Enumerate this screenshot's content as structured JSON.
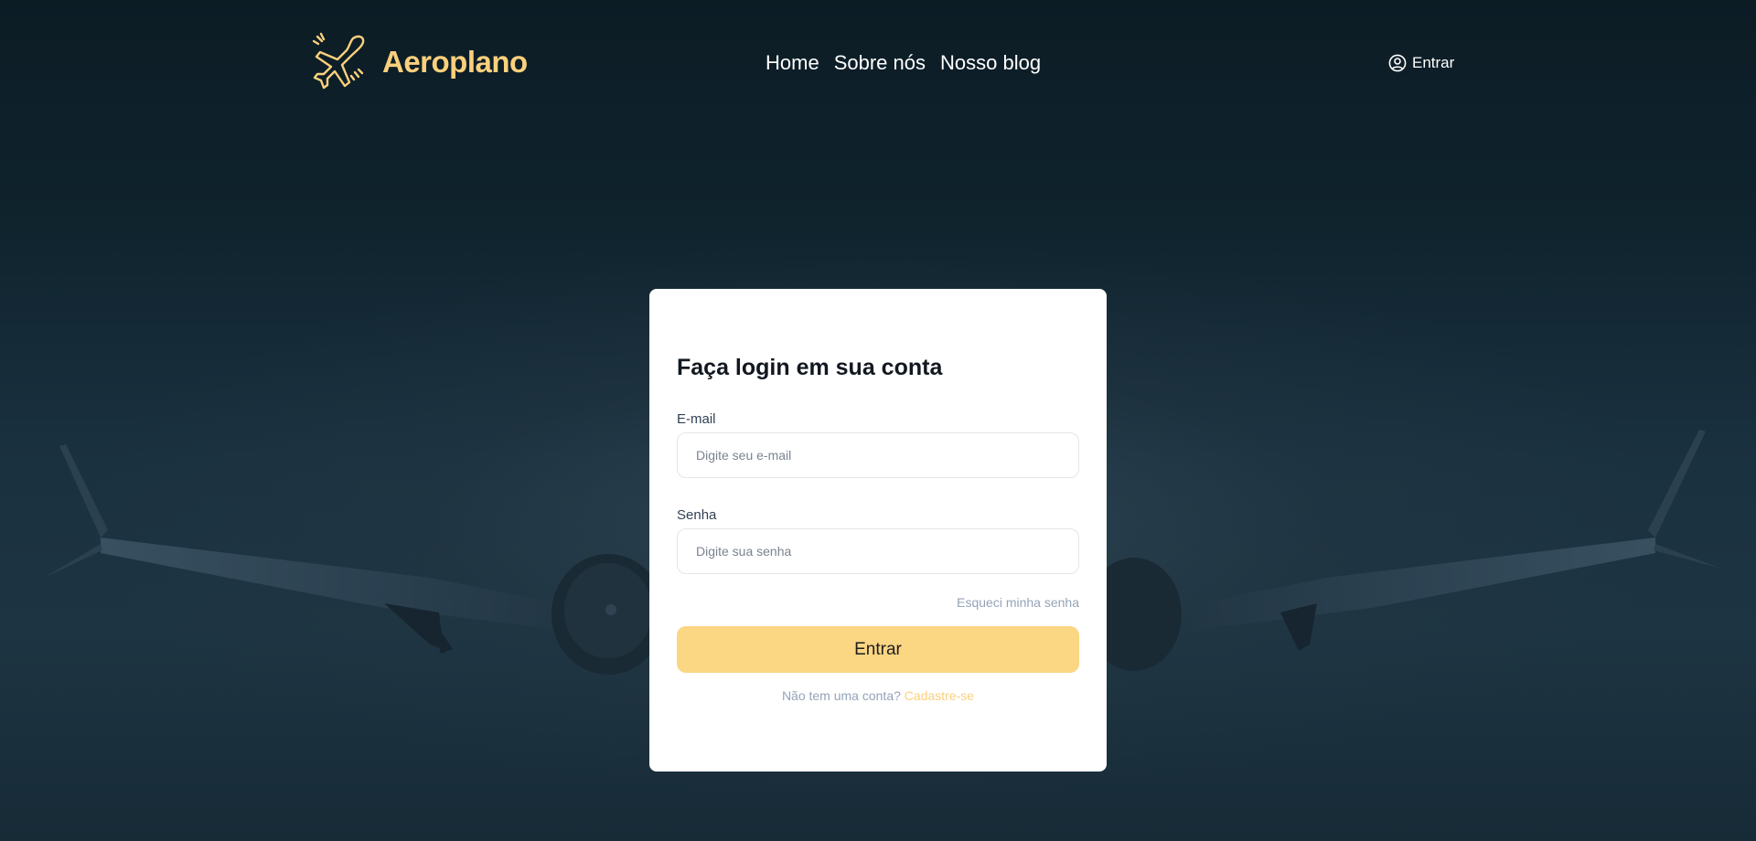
{
  "brand": {
    "name": "Aeroplano",
    "logo_icon": "airplane-icon",
    "accent_color": "#fbd07c"
  },
  "nav": {
    "items": [
      {
        "label": "Home"
      },
      {
        "label": "Sobre nós"
      },
      {
        "label": "Nosso blog"
      }
    ]
  },
  "header": {
    "signin_icon": "user-circle-icon",
    "signin_label": "Entrar"
  },
  "login": {
    "title": "Faça login em sua conta",
    "email_label": "E-mail",
    "email_placeholder": "Digite seu e-mail",
    "password_label": "Senha",
    "password_placeholder": "Digite sua senha",
    "forgot_label": "Esqueci minha senha",
    "submit_label": "Entrar",
    "submit_color": "#fbd683",
    "no_account_text": "Não tem uma conta?",
    "signup_label": "Cadastre-se"
  }
}
